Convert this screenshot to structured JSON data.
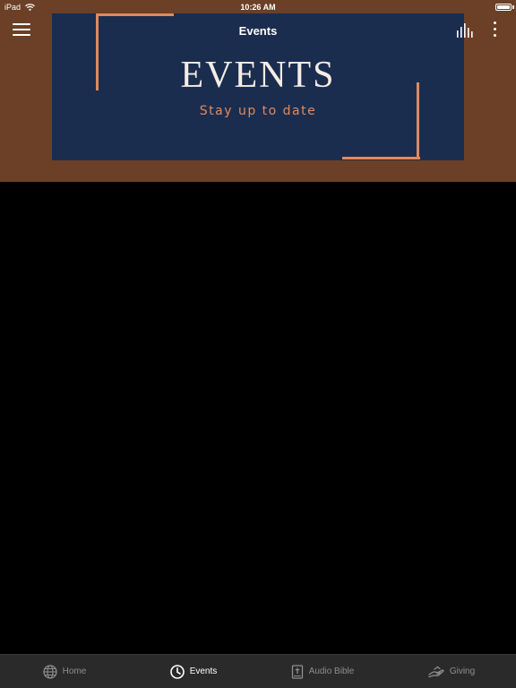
{
  "status_bar": {
    "device": "iPad",
    "time": "10:26 AM"
  },
  "header": {
    "title": "Events",
    "banner": {
      "title": "EVENTS",
      "subtitle": "Stay up to date"
    }
  },
  "tabs": [
    {
      "label": "Home",
      "icon": "globe-icon"
    },
    {
      "label": "Events",
      "icon": "clock-icon",
      "active": true
    },
    {
      "label": "Audio Bible",
      "icon": "bible-icon"
    },
    {
      "label": "Giving",
      "icon": "giving-hand-icon"
    }
  ],
  "colors": {
    "header_bg": "#6b4026",
    "banner_bg": "#1b2d4f",
    "accent": "#e08a5c",
    "tab_bar_bg": "#2a2a2a"
  }
}
